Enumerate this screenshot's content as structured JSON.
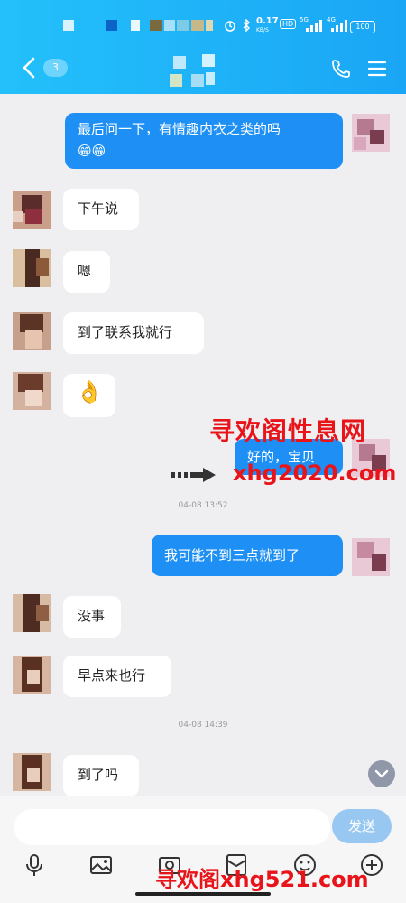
{
  "status_bar": {
    "speed": "0.17",
    "speed_unit": "KB/S",
    "hd": "HD",
    "net1": "5G",
    "net2": "4G",
    "battery": "100"
  },
  "header": {
    "unread_count": "3"
  },
  "messages": [
    {
      "dir": "out",
      "text": "最后问一下，有情趣内衣之类的吗",
      "emoji": "😁😁"
    },
    {
      "dir": "in",
      "text": "下午说"
    },
    {
      "dir": "in",
      "text": "嗯"
    },
    {
      "dir": "in",
      "text": "到了联系我就行"
    },
    {
      "dir": "in",
      "emoji": "👌"
    },
    {
      "dir": "out",
      "text": "好的，宝贝"
    },
    {
      "dir": "out",
      "text": "我可能不到三点就到了"
    },
    {
      "dir": "in",
      "text": "没事"
    },
    {
      "dir": "in",
      "text": "早点来也行"
    },
    {
      "dir": "in",
      "text": "到了吗"
    }
  ],
  "timestamps": [
    "04-08 13:52",
    "04-08 14:39"
  ],
  "input": {
    "placeholder": "",
    "send_label": "发送"
  },
  "watermarks": {
    "line1": "寻欢阁性息网",
    "line2": "xhg2020.com",
    "line3": "寻欢阁xhg521.com"
  },
  "colors": {
    "header_start": "#23c0fb",
    "header_end": "#1aa6f5",
    "bubble_out": "#1e90f5",
    "bubble_in": "#ffffff",
    "watermark": "#e8141a"
  }
}
